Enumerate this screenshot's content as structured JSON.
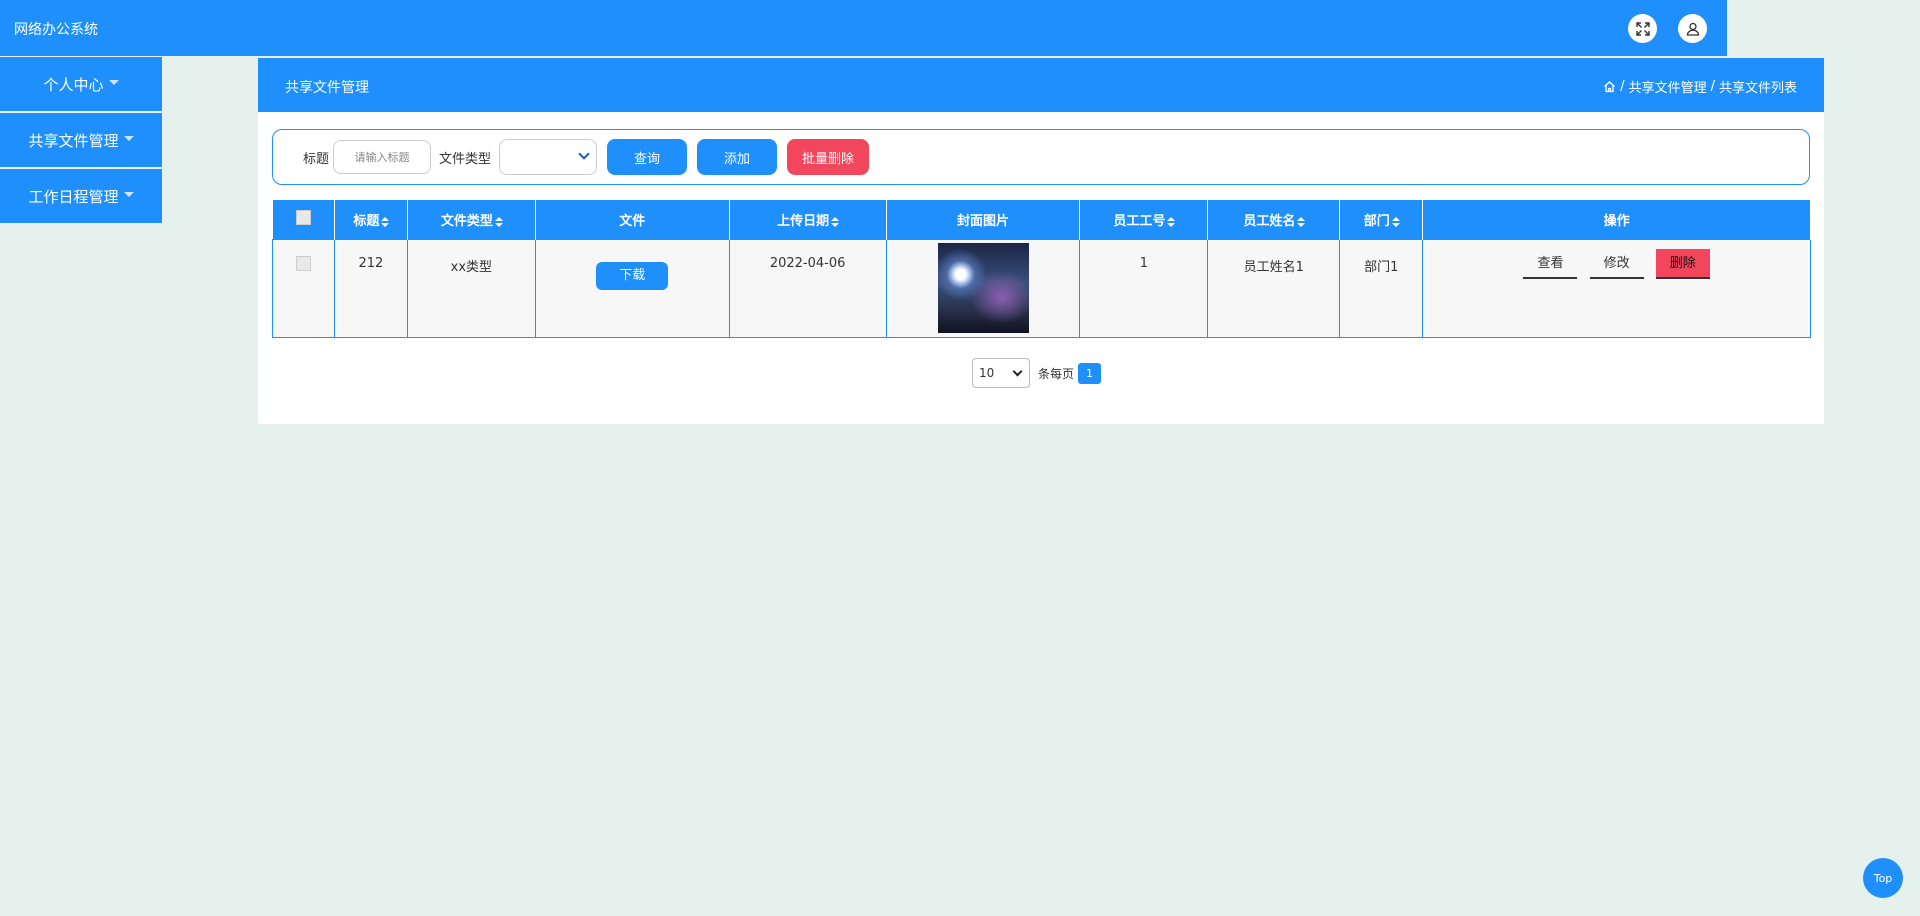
{
  "app": {
    "title": "网络办公系统"
  },
  "header_icons": [
    "fullscreen-icon",
    "user-icon"
  ],
  "sidebar": {
    "items": [
      {
        "label": "个人中心"
      },
      {
        "label": "共享文件管理"
      },
      {
        "label": "工作日程管理"
      }
    ]
  },
  "main": {
    "title": "共享文件管理",
    "breadcrumb": [
      "共享文件管理",
      "共享文件列表"
    ]
  },
  "search": {
    "title_label": "标题",
    "title_placeholder": "请输入标题",
    "type_label": "文件类型",
    "type_value": "",
    "query_button": "查询",
    "add_button": "添加",
    "batch_delete_button": "批量删除"
  },
  "table": {
    "columns": [
      "标题",
      "文件类型",
      "文件",
      "上传日期",
      "封面图片",
      "员工工号",
      "员工姓名",
      "部门",
      "操作"
    ],
    "rows": [
      {
        "title": "212",
        "file_type": "xx类型",
        "file_action": "下载",
        "upload_date": "2022-04-06",
        "cover": "night-sky-image",
        "employee_no": "1",
        "employee_name": "员工姓名1",
        "department": "部门1",
        "actions": {
          "view": "查看",
          "edit": "修改",
          "delete": "删除"
        }
      }
    ]
  },
  "pagination": {
    "page_size": "10",
    "per_page_label": "条每页",
    "current_page": "1"
  },
  "back_to_top": "Top",
  "colors": {
    "primary": "#1e8ffb",
    "danger": "#f2465d",
    "background": "#e5f1ec"
  }
}
